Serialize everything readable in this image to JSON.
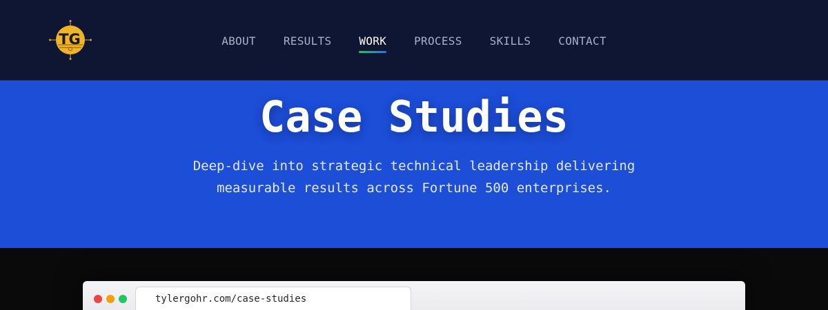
{
  "header": {
    "logo": {
      "text": "TG",
      "icon": "tg-compass-logo",
      "color": "#f0b429"
    },
    "nav": [
      {
        "label": "ABOUT",
        "active": false
      },
      {
        "label": "RESULTS",
        "active": false
      },
      {
        "label": "WORK",
        "active": true
      },
      {
        "label": "PROCESS",
        "active": false
      },
      {
        "label": "SKILLS",
        "active": false
      },
      {
        "label": "CONTACT",
        "active": false
      }
    ]
  },
  "hero": {
    "title": "Case Studies",
    "subtitle_line1": "Deep-dive into strategic technical leadership delivering",
    "subtitle_line2": "measurable results across Fortune 500 enterprises."
  },
  "browser": {
    "url": "tylergohr.com/case-studies",
    "window_controls": [
      "close-dot",
      "minimize-dot",
      "maximize-dot"
    ]
  },
  "colors": {
    "header_bg": "#0e1634",
    "hero_bg": "#1d4ed8",
    "accent_green": "#22c55e",
    "accent_blue": "#2f6fe8",
    "logo_gold": "#f0b429"
  }
}
